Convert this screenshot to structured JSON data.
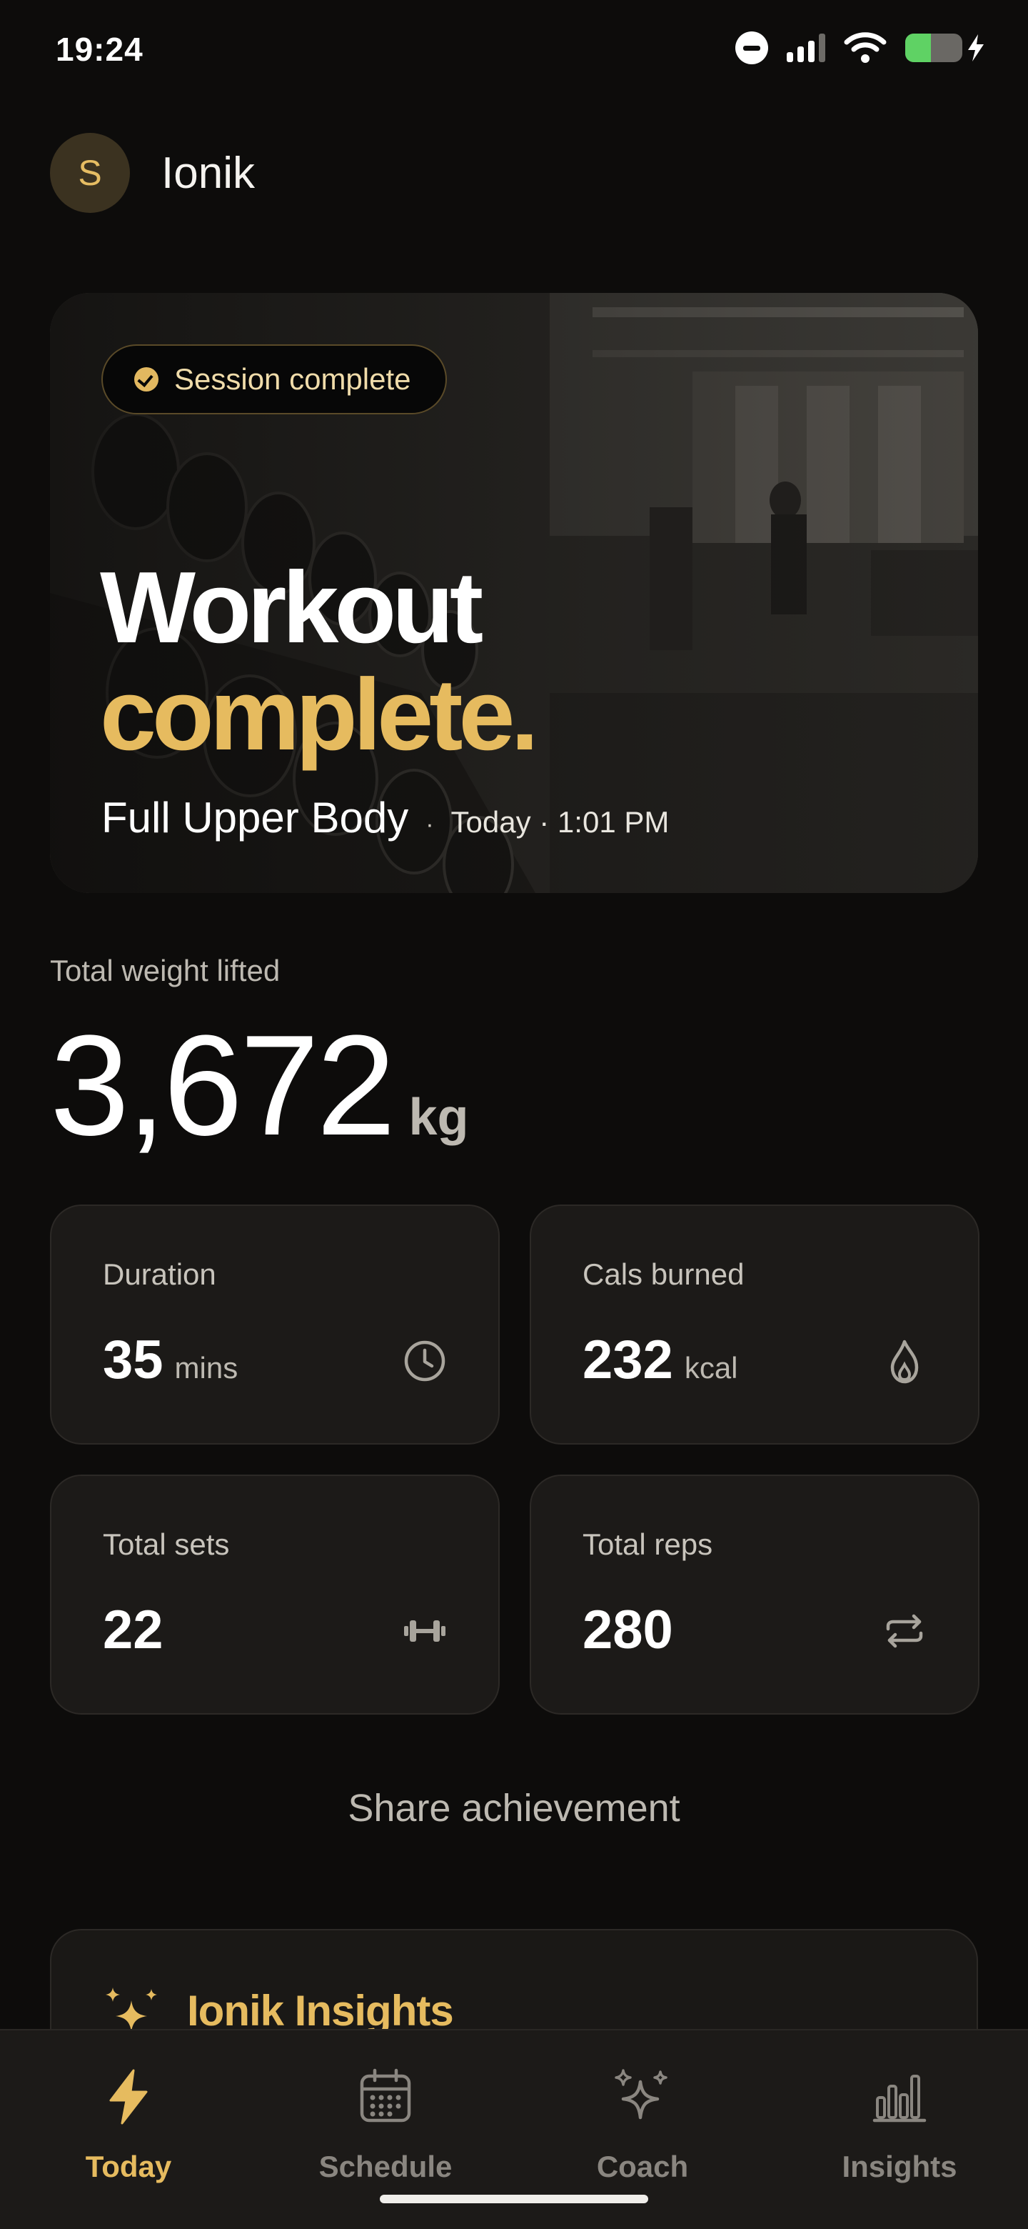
{
  "status_bar": {
    "time": "19:24",
    "battery_level": 0.45,
    "signal_bars_active": 3
  },
  "header": {
    "avatar_initial": "S",
    "title": "Ionik"
  },
  "hero": {
    "badge": "Session complete",
    "title_line_1": "Workout",
    "title_line_2": "complete.",
    "workout_name": "Full Upper Body",
    "separator": "·",
    "when": "Today · 1:01 PM"
  },
  "total": {
    "label": "Total weight lifted",
    "value": "3,672",
    "unit": "kg"
  },
  "stats": [
    {
      "label": "Duration",
      "value": "35",
      "unit": "mins",
      "icon": "clock-icon"
    },
    {
      "label": "Cals burned",
      "value": "232",
      "unit": "kcal",
      "icon": "flame-icon"
    },
    {
      "label": "Total sets",
      "value": "22",
      "unit": "",
      "icon": "dumbbell-icon"
    },
    {
      "label": "Total reps",
      "value": "280",
      "unit": "",
      "icon": "repeat-icon"
    }
  ],
  "share_label": "Share achievement",
  "insights": {
    "title": "Ionik Insights",
    "icon": "sparkles-icon"
  },
  "tabs": [
    {
      "label": "Today",
      "icon": "bolt-icon",
      "active": true
    },
    {
      "label": "Schedule",
      "icon": "calendar-icon",
      "active": false
    },
    {
      "label": "Coach",
      "icon": "sparkles-icon",
      "active": false
    },
    {
      "label": "Insights",
      "icon": "bar-chart-icon",
      "active": false
    }
  ],
  "colors": {
    "accent": "#e6bb5f",
    "background": "#0d0c0b",
    "card": "#1c1a18"
  }
}
